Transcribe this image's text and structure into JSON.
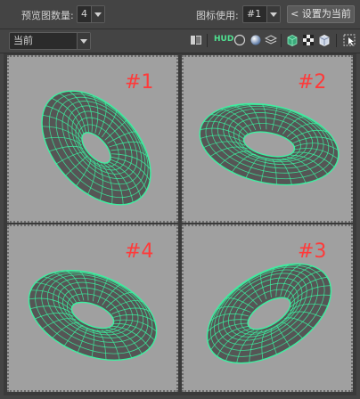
{
  "toolbar": {
    "preview_count_label": "预览图数量:",
    "preview_count_value": "4",
    "icon_use_label": "图标使用:",
    "icon_use_value": "#1",
    "set_current_button": "< 设置为当前"
  },
  "row2": {
    "dropdown_value": "当前",
    "hud_label": "HUD"
  },
  "viewports": [
    {
      "label": "#1"
    },
    {
      "label": "#2"
    },
    {
      "label": "#4"
    },
    {
      "label": "#3"
    }
  ],
  "colors": {
    "mesh_wire": "#3cf0a0",
    "torus_fill": "#555555",
    "label_red": "#ff3a3a"
  }
}
